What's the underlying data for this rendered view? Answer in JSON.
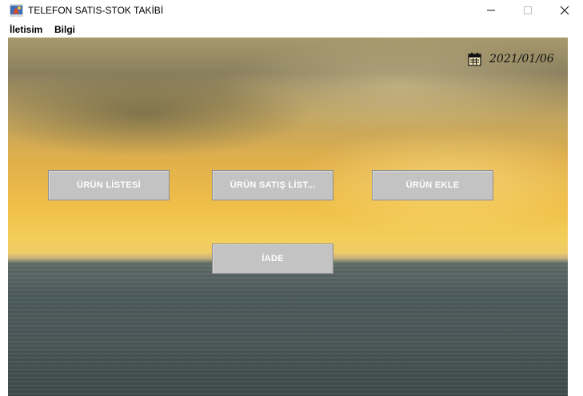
{
  "window": {
    "title": "TELEFON SATIS-STOK TAKİBİ",
    "app_icon": "java-app-icon",
    "controls": {
      "minimize_icon": "minimize-icon",
      "maximize_icon": "maximize-icon",
      "close_icon": "close-icon"
    }
  },
  "menubar": {
    "items": [
      {
        "label": "İletisim"
      },
      {
        "label": "Bilgi"
      }
    ]
  },
  "header": {
    "calendar_icon": "calendar-icon",
    "date": "2021/01/06"
  },
  "buttons": {
    "product_list": "ÜRÜN LİSTESİ",
    "product_sales_list": "ÜRÜN SATIŞ LİST...",
    "add_product": "ÜRÜN EKLE",
    "return": "İADE"
  },
  "colors": {
    "button_bg": "#c3c3c3",
    "button_text": "#ffffff",
    "sky": "#f0c049",
    "sea": "#4c5b5c"
  }
}
